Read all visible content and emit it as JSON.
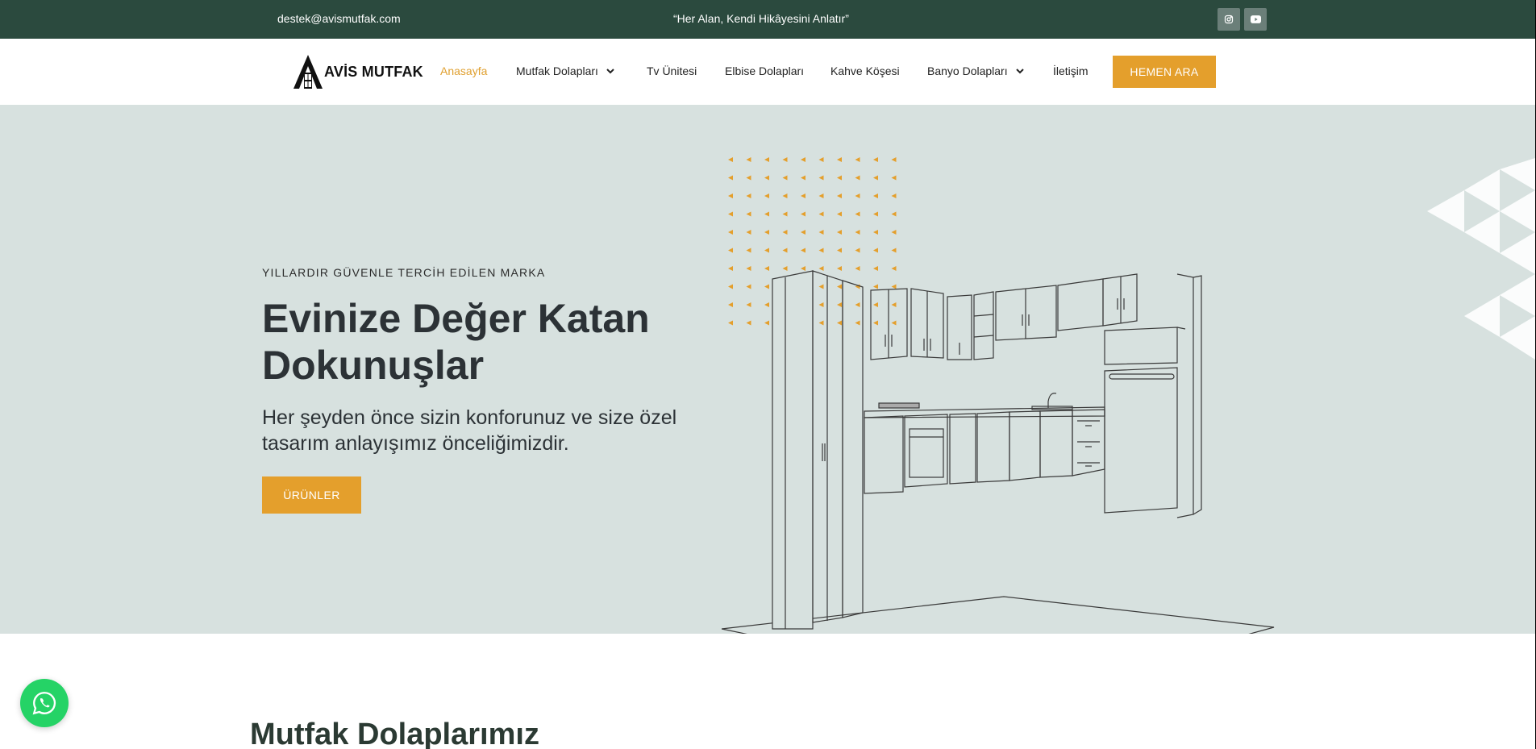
{
  "topbar": {
    "email": "destek@avismutfak.com",
    "motto": "“Her Alan, Kendi Hikâyesini Anlatır”",
    "social": [
      {
        "icon": "instagram-icon"
      },
      {
        "icon": "youtube-icon"
      }
    ]
  },
  "header": {
    "logo_text": "AVİS MUTFAK",
    "nav": [
      {
        "label": "Anasayfa",
        "active": true,
        "dropdown": false
      },
      {
        "label": "Mutfak Dolapları",
        "active": false,
        "dropdown": true
      },
      {
        "label": "Tv Ünitesi",
        "active": false,
        "dropdown": false
      },
      {
        "label": "Elbise Dolapları",
        "active": false,
        "dropdown": false
      },
      {
        "label": "Kahve Köşesi",
        "active": false,
        "dropdown": false
      },
      {
        "label": "Banyo Dolapları",
        "active": false,
        "dropdown": true
      },
      {
        "label": "İletişim",
        "active": false,
        "dropdown": false
      }
    ],
    "cta_label": "HEMEN ARA"
  },
  "hero": {
    "eyebrow": "YILLARDIR GÜVENLE TERCİH EDİLEN MARKA",
    "title": "Evinize Değer Katan Dokunuşlar",
    "subtitle": "Her şeyden önce sizin konforunuz ve size özel tasarım anlayışımız önceliğimizdir.",
    "button_label": "ÜRÜNLER"
  },
  "section": {
    "title": "Mutfak Dolaplarımız"
  },
  "colors": {
    "topbar_bg": "#2b4a3e",
    "accent": "#e49f2c",
    "hero_bg": "#d7e1df",
    "whatsapp": "#25d366"
  }
}
